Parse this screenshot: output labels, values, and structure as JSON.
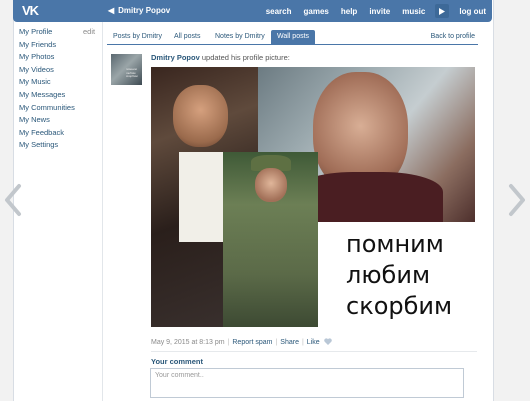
{
  "topbar": {
    "logo": "VK",
    "back_label": "Dmitry Popov",
    "nav": [
      "search",
      "games",
      "help",
      "invite",
      "music",
      "log out"
    ],
    "colors": {
      "bar": "#4a76a8",
      "link": "#2b587a"
    }
  },
  "sidebar": {
    "edit_label": "edit",
    "items": [
      {
        "label": "My Profile"
      },
      {
        "label": "My Friends"
      },
      {
        "label": "My Photos"
      },
      {
        "label": "My Videos"
      },
      {
        "label": "My Music"
      },
      {
        "label": "My Messages"
      },
      {
        "label": "My Communities"
      },
      {
        "label": "My News"
      },
      {
        "label": "My Feedback"
      },
      {
        "label": "My Settings"
      }
    ]
  },
  "tabs": {
    "items": [
      {
        "label": "Posts by Dmitry"
      },
      {
        "label": "All posts"
      },
      {
        "label": "Notes by Dmitry"
      },
      {
        "label": "Wall posts"
      }
    ],
    "active": "Wall posts",
    "back_to_profile": "Back to profile"
  },
  "post": {
    "author": "Dmitry Popov",
    "action": "updated his profile picture:",
    "photo_caption": [
      "помним",
      "любим",
      "скорбим"
    ],
    "date": "May 9, 2015 at 8:13 pm",
    "report_label": "Report spam",
    "share_label": "Share",
    "like_label": "Like"
  },
  "comment": {
    "label": "Your comment",
    "placeholder": "Your comment.."
  },
  "icons": {
    "logo": "vk-logo-icon",
    "back": "chevron-left-icon",
    "player": "play-icon",
    "prev": "chevron-left-icon",
    "next": "chevron-right-icon",
    "like": "heart-icon"
  }
}
